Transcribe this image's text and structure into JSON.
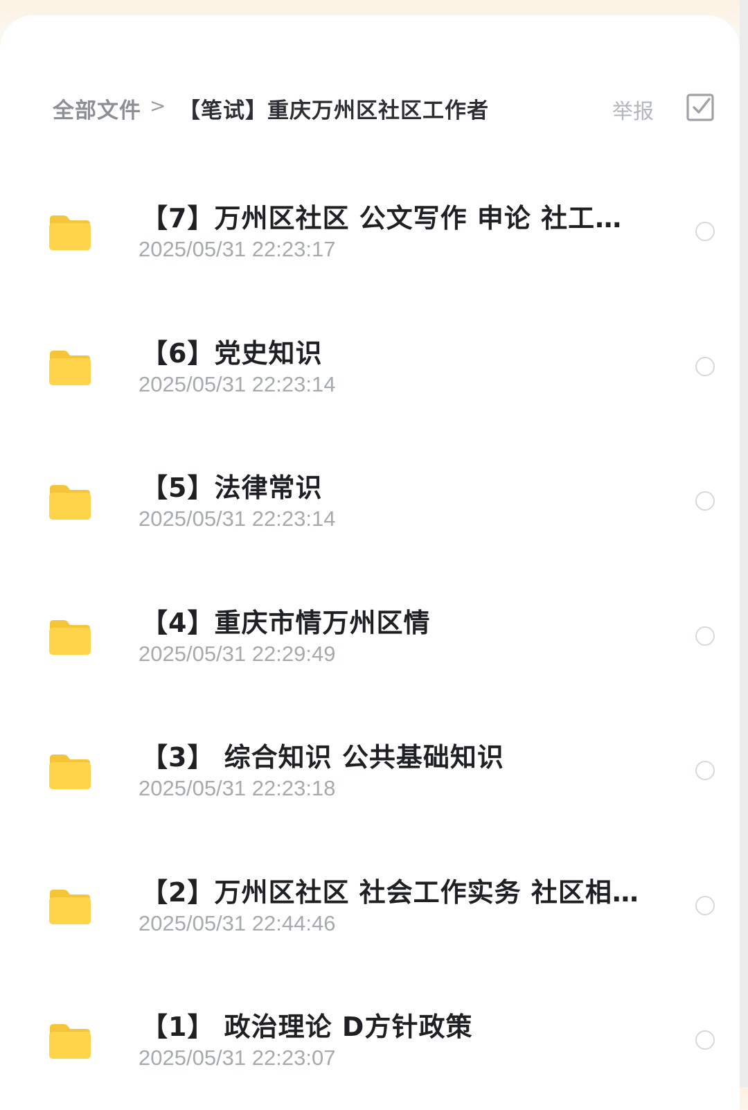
{
  "breadcrumb": {
    "root": "全部文件",
    "separator": ">",
    "current": "【笔试】重庆万州区社区工作者"
  },
  "actions": {
    "report_label": "举报",
    "select_icon": "checkbox-select-icon"
  },
  "colors": {
    "folder": "#FFD44A",
    "folder_back": "#F6C439"
  },
  "files": [
    {
      "name": "【7】万州区社区 公文写作 申论 社工一…",
      "time": "2025/05/31 22:23:17"
    },
    {
      "name": "【6】党史知识",
      "time": "2025/05/31 22:23:14"
    },
    {
      "name": "【5】法律常识",
      "time": "2025/05/31 22:23:14"
    },
    {
      "name": "【4】重庆市情万州区情",
      "time": "2025/05/31 22:29:49"
    },
    {
      "name": "【3】 综合知识 公共基础知识",
      "time": "2025/05/31 22:23:18"
    },
    {
      "name": "【2】万州区社区 社会工作实务 社区相…",
      "time": "2025/05/31 22:44:46"
    },
    {
      "name": "【1】 政治理论 D方针政策",
      "time": "2025/05/31 22:23:07"
    }
  ]
}
